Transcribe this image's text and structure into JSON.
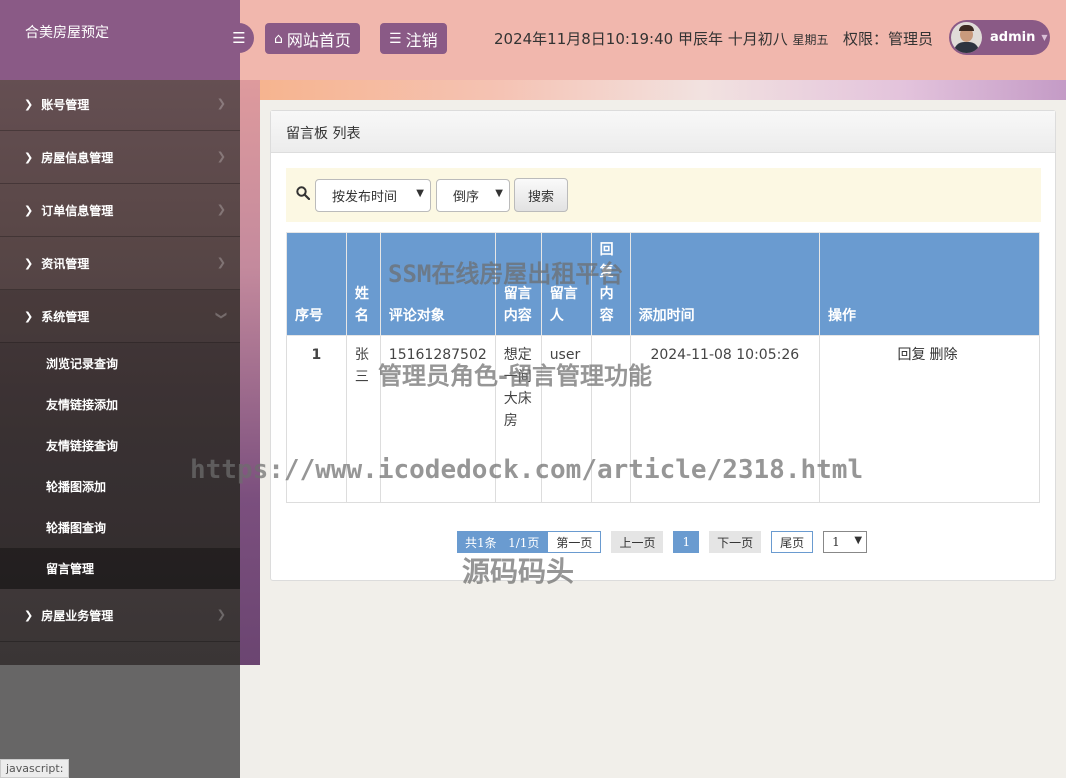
{
  "brand": "合美房屋预定",
  "header": {
    "home_label": "网站首页",
    "logout_label": "注销",
    "datetime": "2024年11月8日10:19:40 甲辰年 十月初八",
    "weekday": "星期五",
    "role_text": "权限：管理员",
    "username": "admin"
  },
  "sidebar": {
    "items": [
      {
        "label": "账号管理"
      },
      {
        "label": "房屋信息管理"
      },
      {
        "label": "订单信息管理"
      },
      {
        "label": "资讯管理"
      },
      {
        "label": "系统管理"
      },
      {
        "label": "房屋业务管理"
      }
    ],
    "sub_items": [
      {
        "label": "浏览记录查询"
      },
      {
        "label": "友情链接添加"
      },
      {
        "label": "友情链接查询"
      },
      {
        "label": "轮播图添加"
      },
      {
        "label": "轮播图查询"
      },
      {
        "label": "留言管理"
      }
    ]
  },
  "panel": {
    "title": "留言板 列表"
  },
  "search": {
    "sort_field": "按发布时间",
    "sort_order": "倒序",
    "button": "搜索"
  },
  "table": {
    "headers": [
      "序号",
      "姓名",
      "评论对象",
      "留言内容",
      "留言人",
      "回复内容",
      "添加时间",
      "操作"
    ],
    "rows": [
      {
        "index": "1",
        "name": "张三",
        "target": "15161287502",
        "content": "想定一间大床房",
        "author": "user",
        "reply": "",
        "time": "2024-11-08 10:05:26",
        "action_reply": "回复",
        "action_delete": "删除"
      }
    ]
  },
  "pager": {
    "total": "共1条",
    "pages": "1/1页",
    "first": "第一页",
    "prev": "上一页",
    "current": "1",
    "next": "下一页",
    "last": "尾页",
    "select_value": "1"
  },
  "status_bar": "javascript:",
  "watermarks": {
    "line1": "SSM在线房屋出租平台",
    "line2": "管理员角色-留言管理功能",
    "line3": "https://www.icodedock.com/article/2318.html",
    "line4": "源码码头"
  }
}
